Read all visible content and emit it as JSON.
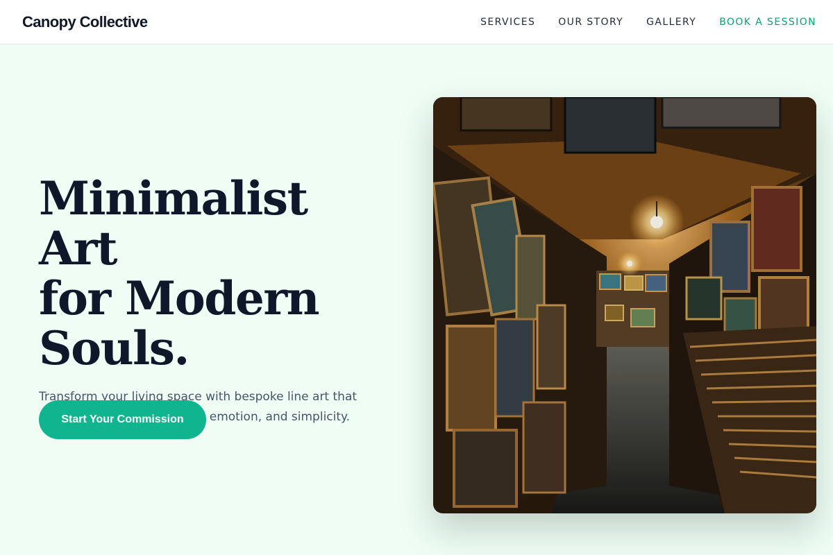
{
  "header": {
    "brand": "Canopy Collective",
    "nav": [
      {
        "label": "SERVICES"
      },
      {
        "label": "OUR STORY"
      },
      {
        "label": "GALLERY"
      },
      {
        "label": "BOOK A SESSION"
      }
    ]
  },
  "hero": {
    "headline_line1": "Minimalist Art",
    "headline_line2": "for Modern",
    "headline_line3": "Souls.",
    "subtext": "Transform your living space with bespoke line art that captures the essence of life, emotion, and simplicity.",
    "cta_label": "Start Your Commission"
  },
  "colors": {
    "background": "#effdf5",
    "accent": "#0f9f6e",
    "button": "#10b58f",
    "heading": "#0f172a"
  }
}
